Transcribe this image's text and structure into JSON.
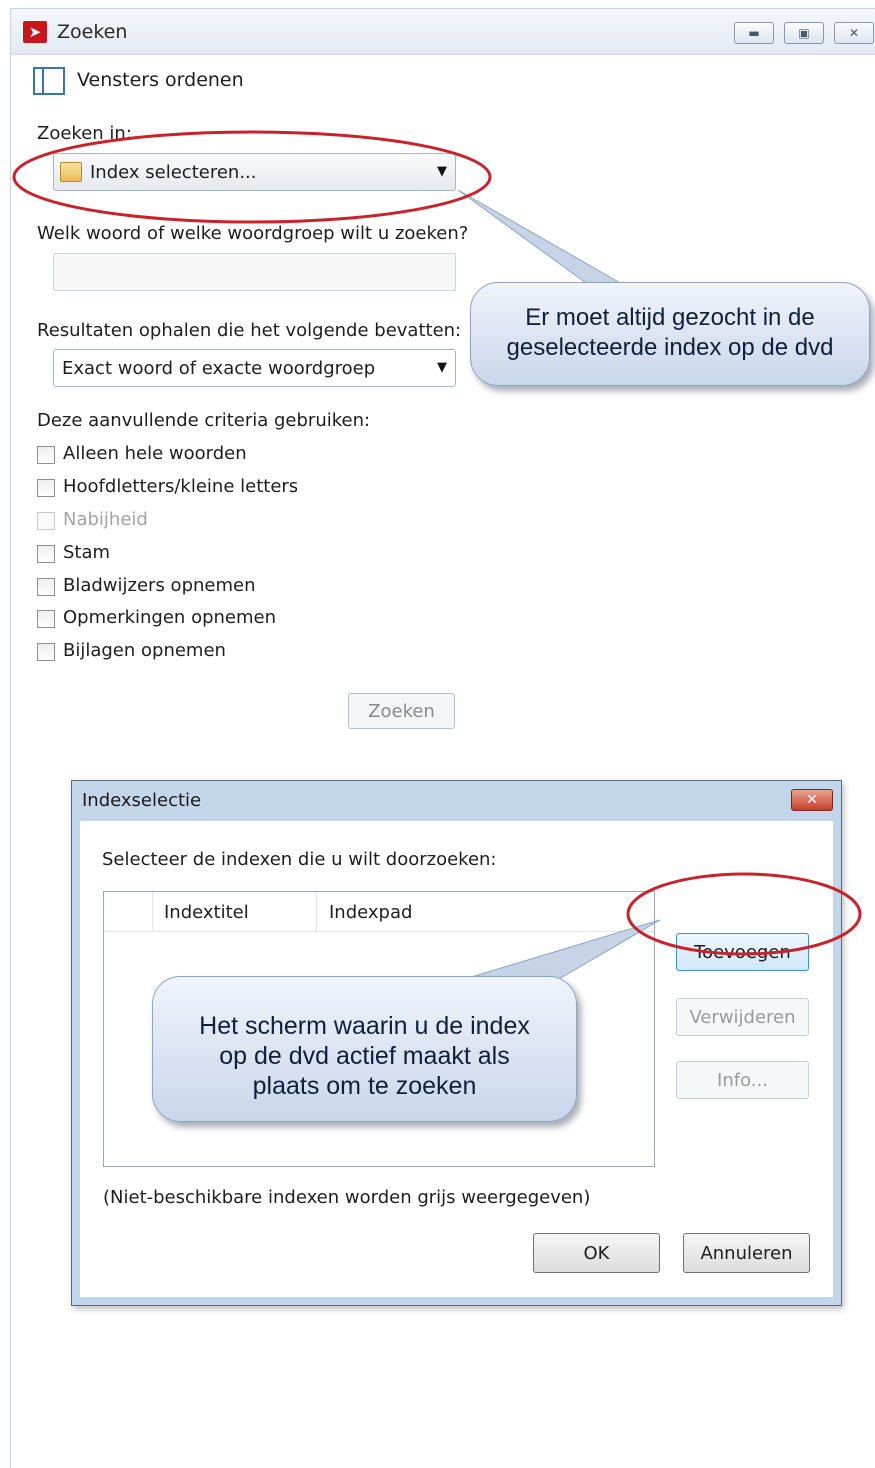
{
  "window": {
    "title": "Zoeken",
    "buttons": [
      "minimize",
      "maximize",
      "close"
    ]
  },
  "arrange_label": "Vensters ordenen",
  "search_in": {
    "label": "Zoeken in:",
    "value": "Index selecteren..."
  },
  "query": {
    "label": "Welk woord of welke woordgroep wilt u zoeken?",
    "value": ""
  },
  "results": {
    "label": "Resultaten ophalen die het volgende bevatten:",
    "value": "Exact woord of exacte woordgroep"
  },
  "criteria": {
    "label": "Deze aanvullende criteria gebruiken:",
    "items": [
      {
        "label": "Alleen hele woorden",
        "checked": false,
        "enabled": true
      },
      {
        "label": "Hoofdletters/kleine letters",
        "checked": false,
        "enabled": true
      },
      {
        "label": "Nabijheid",
        "checked": false,
        "enabled": false
      },
      {
        "label": "Stam",
        "checked": false,
        "enabled": true
      },
      {
        "label": "Bladwijzers opnemen",
        "checked": false,
        "enabled": true
      },
      {
        "label": "Opmerkingen opnemen",
        "checked": false,
        "enabled": true
      },
      {
        "label": "Bijlagen opnemen",
        "checked": false,
        "enabled": true
      }
    ]
  },
  "search_button": "Zoeken",
  "callout_1": {
    "lines": [
      "Er moet altijd gezocht in de",
      "geselecteerde index op de dvd"
    ]
  },
  "dialog": {
    "title": "Indexselectie",
    "prompt": "Selecteer de indexen die u wilt doorzoeken:",
    "columns": [
      "Indextitel",
      "Indexpad"
    ],
    "rows": [],
    "buttons": {
      "add": "Toevoegen",
      "remove": "Verwijderen",
      "info": "Info...",
      "ok": "OK",
      "cancel": "Annuleren"
    },
    "note": "(Niet-beschikbare indexen worden grijs weergegeven)"
  },
  "callout_2": {
    "lines": [
      "Het scherm waarin u de index",
      "op de dvd actief maakt als",
      "plaats om te zoeken"
    ]
  },
  "colors": {
    "highlight_ellipse": "#c8232c",
    "callout_fill": "#dbe4f3",
    "dialog_frame": "#c4d6ea"
  }
}
